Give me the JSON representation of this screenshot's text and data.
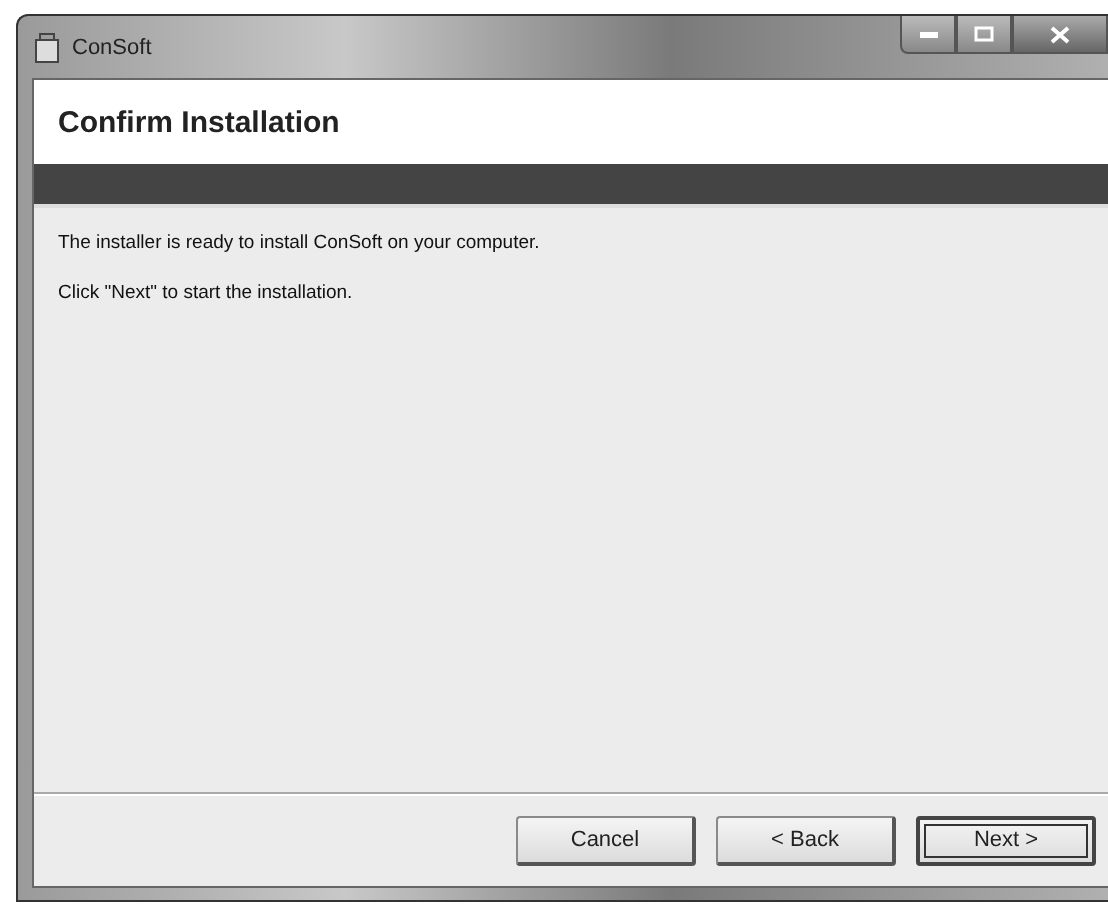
{
  "window": {
    "title": "ConSoft"
  },
  "header": {
    "title": "Confirm Installation"
  },
  "body": {
    "paragraphs": [
      "The installer is ready to install ConSoft on your computer.",
      "Click \"Next\" to start the installation."
    ]
  },
  "buttons": [
    {
      "label": "Cancel",
      "default": false
    },
    {
      "label": "< Back",
      "default": false
    },
    {
      "label": "Next >",
      "default": true
    }
  ]
}
